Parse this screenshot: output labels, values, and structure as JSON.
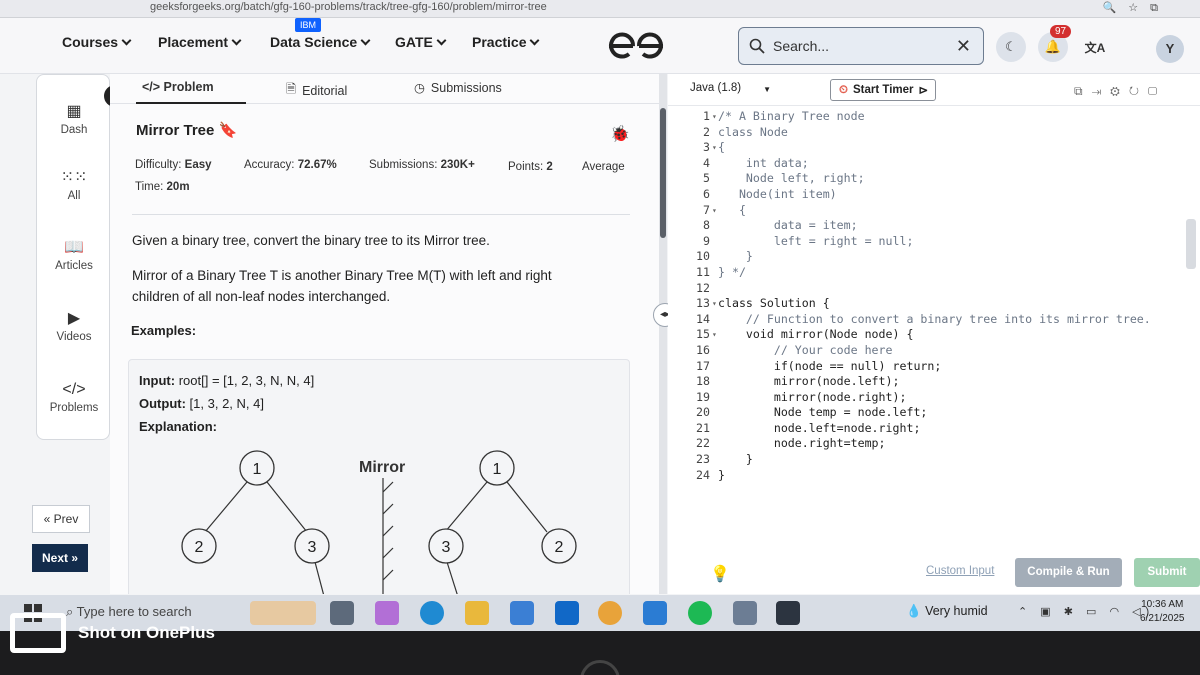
{
  "browser": {
    "url": "geeksforgeeks.org/batch/gfg-160-problems/track/tree-gfg-160/problem/mirror-tree"
  },
  "nav": {
    "items": [
      "Courses",
      "Placement",
      "Data Science",
      "GATE",
      "Practice"
    ],
    "ibm_badge": "IBM",
    "search_placeholder": "Search...",
    "notification_count": "97",
    "avatar_initial": "Y"
  },
  "sidebar": {
    "items": [
      {
        "label": "Dash",
        "icon": "dashboard-icon"
      },
      {
        "label": "All",
        "icon": "grid-icon"
      },
      {
        "label": "Articles",
        "icon": "book-icon"
      },
      {
        "label": "Videos",
        "icon": "video-icon"
      },
      {
        "label": "Problems",
        "icon": "code-icon"
      }
    ],
    "prev_label": "« Prev",
    "next_label": "Next »"
  },
  "problem": {
    "tabs": [
      "</> Problem",
      "Editorial",
      "Submissions"
    ],
    "title": "Mirror Tree",
    "difficulty_label": "Difficulty:",
    "difficulty": "Easy",
    "accuracy_label": "Accuracy:",
    "accuracy": "72.67%",
    "submissions_label": "Submissions:",
    "submissions": "230K+",
    "points_label": "Points:",
    "points": "2",
    "average": "Average",
    "time_label": "Time:",
    "time": "20m",
    "description_1": "Given a binary tree, convert the binary tree to its Mirror tree.",
    "description_2a": "Mirror of a Binary Tree T is another Binary Tree M(T) with left and right",
    "description_2b": "children of all non-leaf nodes interchanged.",
    "examples_heading": "Examples:",
    "example": {
      "input_label": "Input:",
      "input": "root[] = [1, 2, 3, N, N, 4]",
      "output_label": "Output:",
      "output": "[1, 3, 2, N, 4]",
      "explanation_label": "Explanation:",
      "diagram_label": "Mirror",
      "left_tree": {
        "root": "1",
        "left": "2",
        "right": "3"
      },
      "right_tree": {
        "root": "1",
        "left": "3",
        "right": "2"
      }
    }
  },
  "editor": {
    "language": "Java (1.8)",
    "timer_label": "Start Timer",
    "lines": [
      {
        "n": "1",
        "fold": "▾",
        "code": "/* A Binary Tree node",
        "c": "comment"
      },
      {
        "n": "2",
        "fold": "",
        "code": "class Node",
        "c": "comment"
      },
      {
        "n": "3",
        "fold": "▾",
        "code": "{",
        "c": "comment"
      },
      {
        "n": "4",
        "fold": "",
        "code": "    int data;",
        "c": "comment"
      },
      {
        "n": "5",
        "fold": "",
        "code": "    Node left, right;",
        "c": "comment"
      },
      {
        "n": "6",
        "fold": "",
        "code": "   Node(int item)",
        "c": "comment"
      },
      {
        "n": "7",
        "fold": "▾",
        "code": "   {",
        "c": "comment"
      },
      {
        "n": "8",
        "fold": "",
        "code": "        data = item;",
        "c": "comment"
      },
      {
        "n": "9",
        "fold": "",
        "code": "        left = right = null;",
        "c": "comment"
      },
      {
        "n": "10",
        "fold": "",
        "code": "    }",
        "c": "comment"
      },
      {
        "n": "11",
        "fold": "",
        "code": "} */",
        "c": "comment"
      },
      {
        "n": "12",
        "fold": "",
        "code": "",
        "c": "plain"
      },
      {
        "n": "13",
        "fold": "▾",
        "code": "class Solution {",
        "c": "plain"
      },
      {
        "n": "14",
        "fold": "",
        "code": "    // Function to convert a binary tree into its mirror tree.",
        "c": "comment"
      },
      {
        "n": "15",
        "fold": "▾",
        "code": "    void mirror(Node node) {",
        "c": "plain"
      },
      {
        "n": "16",
        "fold": "",
        "code": "        // Your code here",
        "c": "comment"
      },
      {
        "n": "17",
        "fold": "",
        "code": "        if(node == null) return;",
        "c": "plain"
      },
      {
        "n": "18",
        "fold": "",
        "code": "        mirror(node.left);",
        "c": "plain"
      },
      {
        "n": "19",
        "fold": "",
        "code": "        mirror(node.right);",
        "c": "plain"
      },
      {
        "n": "20",
        "fold": "",
        "code": "        Node temp = node.left;",
        "c": "plain"
      },
      {
        "n": "21",
        "fold": "",
        "code": "        node.left=node.right;",
        "c": "plain"
      },
      {
        "n": "22",
        "fold": "",
        "code": "        node.right=temp;",
        "c": "plain"
      },
      {
        "n": "23",
        "fold": "",
        "code": "    }",
        "c": "plain"
      },
      {
        "n": "24",
        "fold": "",
        "code": "}",
        "c": "plain"
      }
    ],
    "custom_input": "Custom Input",
    "compile_run": "Compile & Run",
    "submit": "Submit"
  },
  "taskbar": {
    "search_placeholder": "Type here to search",
    "weather": "Very humid",
    "time": "10:36 AM",
    "date": "6/21/2025"
  },
  "watermark": "Shot on OnePlus",
  "colors": {
    "nav_dark": "#132c4c",
    "comment": "#6b7686",
    "keyword": "#2a5db0",
    "notif": "#d32f2f",
    "submit": "#9fd1b1"
  }
}
